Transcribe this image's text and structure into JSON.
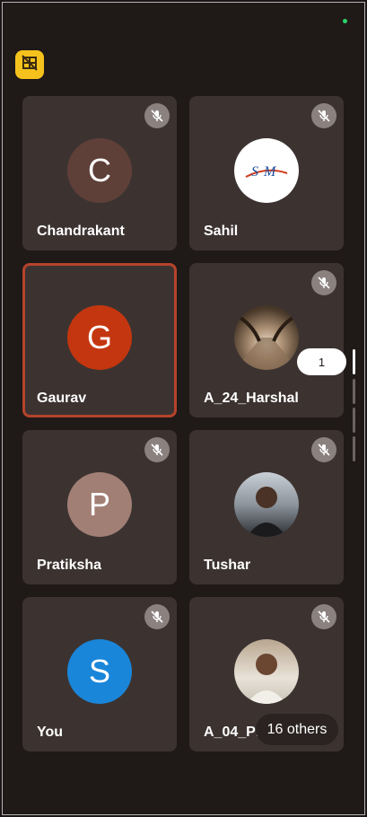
{
  "colors": {
    "accent_layout": "#f5c21d",
    "tile_bg": "#3c3331",
    "active_border": "#b5432b"
  },
  "participants": [
    {
      "name": "Chandrakant",
      "initial": "C",
      "avatar_color": "#5f4039",
      "muted": true
    },
    {
      "name": "Sahil",
      "initial": "",
      "avatar_logo": "SM",
      "muted": true
    },
    {
      "name": "Gaurav",
      "initial": "G",
      "avatar_color": "#c4360f",
      "muted": false,
      "speaking": true
    },
    {
      "name": "A_24_Harshal",
      "initial": "",
      "avatar_photo": "tree-tunnel-photo",
      "muted": true
    },
    {
      "name": "Pratiksha",
      "initial": "P",
      "avatar_color": "#a27f74",
      "muted": true
    },
    {
      "name": "Tushar",
      "initial": "",
      "avatar_photo": "person-photo",
      "muted": true
    },
    {
      "name": "You",
      "initial": "S",
      "avatar_color": "#1a86d9",
      "muted": true
    },
    {
      "name": "A_04_Pra",
      "initial": "",
      "avatar_photo": "person-photo",
      "muted": true
    }
  ],
  "page_indicator": "1",
  "others_label": "16 others",
  "logo_text": "SM"
}
